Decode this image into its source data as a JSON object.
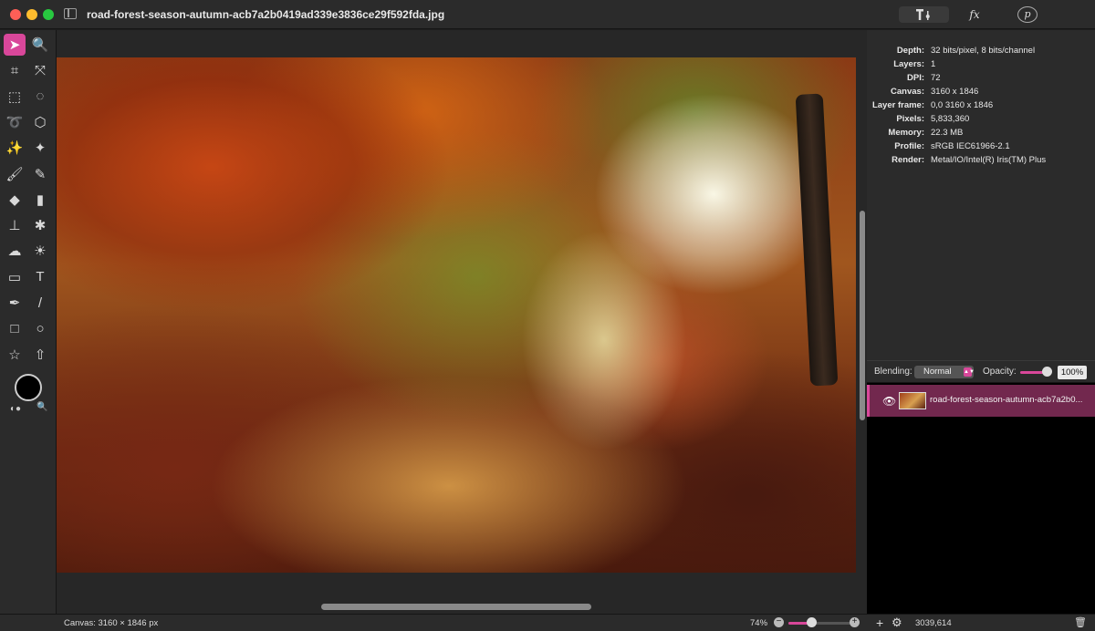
{
  "window": {
    "title": "road-forest-season-autumn-acb7a2b0419ad339e3836ce29f592fda.jpg"
  },
  "toolbar": {
    "adjust_icon": "T-adjust-icon",
    "fx_label": "fx",
    "plugins_label": "p"
  },
  "tools": [
    {
      "name": "arrow-tool",
      "glyph": "➤",
      "active": true
    },
    {
      "name": "zoom-tool",
      "glyph": "🔍"
    },
    {
      "name": "crop-tool",
      "glyph": "⌗"
    },
    {
      "name": "transform-tool",
      "glyph": "⤧"
    },
    {
      "name": "rect-select-tool",
      "glyph": "⬚"
    },
    {
      "name": "ellipse-select-tool",
      "glyph": "◌"
    },
    {
      "name": "lasso-tool",
      "glyph": "➰"
    },
    {
      "name": "polygon-lasso-tool",
      "glyph": "⬡"
    },
    {
      "name": "magic-wand-tool",
      "glyph": "✨"
    },
    {
      "name": "quick-select-tool",
      "glyph": "✦"
    },
    {
      "name": "brush-tool",
      "glyph": "🖌"
    },
    {
      "name": "pencil-tool",
      "glyph": "✎"
    },
    {
      "name": "paint-bucket-tool",
      "glyph": "◆"
    },
    {
      "name": "eraser-tool",
      "glyph": "▮"
    },
    {
      "name": "clone-stamp-tool",
      "glyph": "⊥"
    },
    {
      "name": "repair-tool",
      "glyph": "✱"
    },
    {
      "name": "smudge-tool",
      "glyph": "☁"
    },
    {
      "name": "dodge-tool",
      "glyph": "☀"
    },
    {
      "name": "gradient-tool",
      "glyph": "▭"
    },
    {
      "name": "text-tool",
      "glyph": "T"
    },
    {
      "name": "pen-tool",
      "glyph": "✒"
    },
    {
      "name": "line-tool",
      "glyph": "/"
    },
    {
      "name": "rectangle-tool",
      "glyph": "□"
    },
    {
      "name": "ellipse-tool",
      "glyph": "○"
    },
    {
      "name": "star-tool",
      "glyph": "☆"
    },
    {
      "name": "arrow-shape-tool",
      "glyph": "⇧"
    }
  ],
  "info": [
    {
      "label": "Depth:",
      "value": "32 bits/pixel, 8 bits/channel"
    },
    {
      "label": "Layers:",
      "value": "1"
    },
    {
      "label": "DPI:",
      "value": "72"
    },
    {
      "label": "Canvas:",
      "value": "3160 x 1846"
    },
    {
      "label": "Layer frame:",
      "value": "0,0 3160 x 1846"
    },
    {
      "label": "Pixels:",
      "value": "5,833,360"
    },
    {
      "label": "Memory:",
      "value": "22.3 MB"
    },
    {
      "label": "Profile:",
      "value": "sRGB IEC61966-2.1"
    },
    {
      "label": "Render:",
      "value": "Metal/IO/Intel(R) Iris(TM) Plus"
    }
  ],
  "layers_panel": {
    "blending_label": "Blending:",
    "blending_value": "Normal",
    "opacity_label": "Opacity:",
    "opacity_value": "100%",
    "opacity_level": 1.0,
    "layer": {
      "name": "road-forest-season-autumn-acb7a2b0...",
      "visible": true
    }
  },
  "status": {
    "canvas_text": "Canvas: 3160 × 1846 px",
    "zoom_text": "74%",
    "zoom_level": 0.74,
    "cursor_coords": "3039,614"
  },
  "colors": {
    "accent": "#d9479a",
    "panel": "#2b2b2b",
    "selected_layer": "#72284e"
  }
}
